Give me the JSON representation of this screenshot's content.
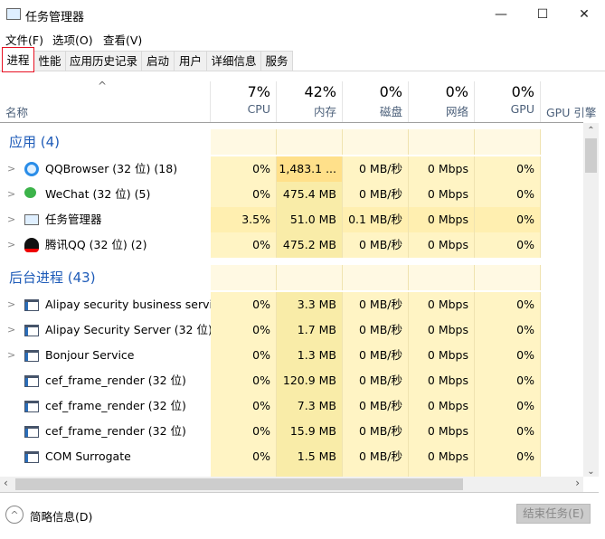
{
  "window": {
    "title": "任务管理器",
    "minimize": "—",
    "maximize": "☐",
    "close": "✕"
  },
  "menu": [
    "文件(F)",
    "选项(O)",
    "查看(V)"
  ],
  "tabs": [
    "进程",
    "性能",
    "应用历史记录",
    "启动",
    "用户",
    "详细信息",
    "服务"
  ],
  "columns": {
    "name": "名称",
    "sort_indicator": "^",
    "cpu": {
      "pct": "7%",
      "label": "CPU"
    },
    "mem": {
      "pct": "42%",
      "label": "内存"
    },
    "disk": {
      "pct": "0%",
      "label": "磁盘"
    },
    "net": {
      "pct": "0%",
      "label": "网络"
    },
    "gpu": {
      "pct": "0%",
      "label": "GPU"
    },
    "gpu_engine": {
      "label": "GPU 引擎"
    }
  },
  "groups": {
    "apps": "应用 (4)",
    "background": "后台进程 (43)"
  },
  "apps": [
    {
      "name": "QQBrowser (32 位) (18)",
      "icon": "qqbrowser-icon",
      "cpu": "0%",
      "mem": "1,483.1 ...",
      "disk": "0 MB/秒",
      "net": "0 Mbps",
      "gpu": "0%"
    },
    {
      "name": "WeChat (32 位) (5)",
      "icon": "wechat-icon",
      "cpu": "0%",
      "mem": "475.4 MB",
      "disk": "0 MB/秒",
      "net": "0 Mbps",
      "gpu": "0%"
    },
    {
      "name": "任务管理器",
      "icon": "task-manager-icon",
      "cpu": "3.5%",
      "mem": "51.0 MB",
      "disk": "0.1 MB/秒",
      "net": "0 Mbps",
      "gpu": "0%"
    },
    {
      "name": "腾讯QQ (32 位) (2)",
      "icon": "qq-penguin-icon",
      "cpu": "0%",
      "mem": "475.2 MB",
      "disk": "0 MB/秒",
      "net": "0 Mbps",
      "gpu": "0%"
    }
  ],
  "background": [
    {
      "name": "Alipay security business servi...",
      "expand": true,
      "cpu": "0%",
      "mem": "3.3 MB",
      "disk": "0 MB/秒",
      "net": "0 Mbps",
      "gpu": "0%"
    },
    {
      "name": "Alipay Security Server (32 位)",
      "expand": true,
      "cpu": "0%",
      "mem": "1.7 MB",
      "disk": "0 MB/秒",
      "net": "0 Mbps",
      "gpu": "0%"
    },
    {
      "name": "Bonjour Service",
      "expand": true,
      "cpu": "0%",
      "mem": "1.3 MB",
      "disk": "0 MB/秒",
      "net": "0 Mbps",
      "gpu": "0%"
    },
    {
      "name": "cef_frame_render (32 位)",
      "expand": false,
      "cpu": "0%",
      "mem": "120.9 MB",
      "disk": "0 MB/秒",
      "net": "0 Mbps",
      "gpu": "0%"
    },
    {
      "name": "cef_frame_render (32 位)",
      "expand": false,
      "cpu": "0%",
      "mem": "7.3 MB",
      "disk": "0 MB/秒",
      "net": "0 Mbps",
      "gpu": "0%"
    },
    {
      "name": "cef_frame_render (32 位)",
      "expand": false,
      "cpu": "0%",
      "mem": "15.9 MB",
      "disk": "0 MB/秒",
      "net": "0 Mbps",
      "gpu": "0%"
    },
    {
      "name": "COM Surrogate",
      "expand": false,
      "cpu": "0%",
      "mem": "1.5 MB",
      "disk": "0 MB/秒",
      "net": "0 Mbps",
      "gpu": "0%"
    }
  ],
  "footer": {
    "fewer_details": "简略信息(D)",
    "end_task": "结束任务(E)"
  }
}
